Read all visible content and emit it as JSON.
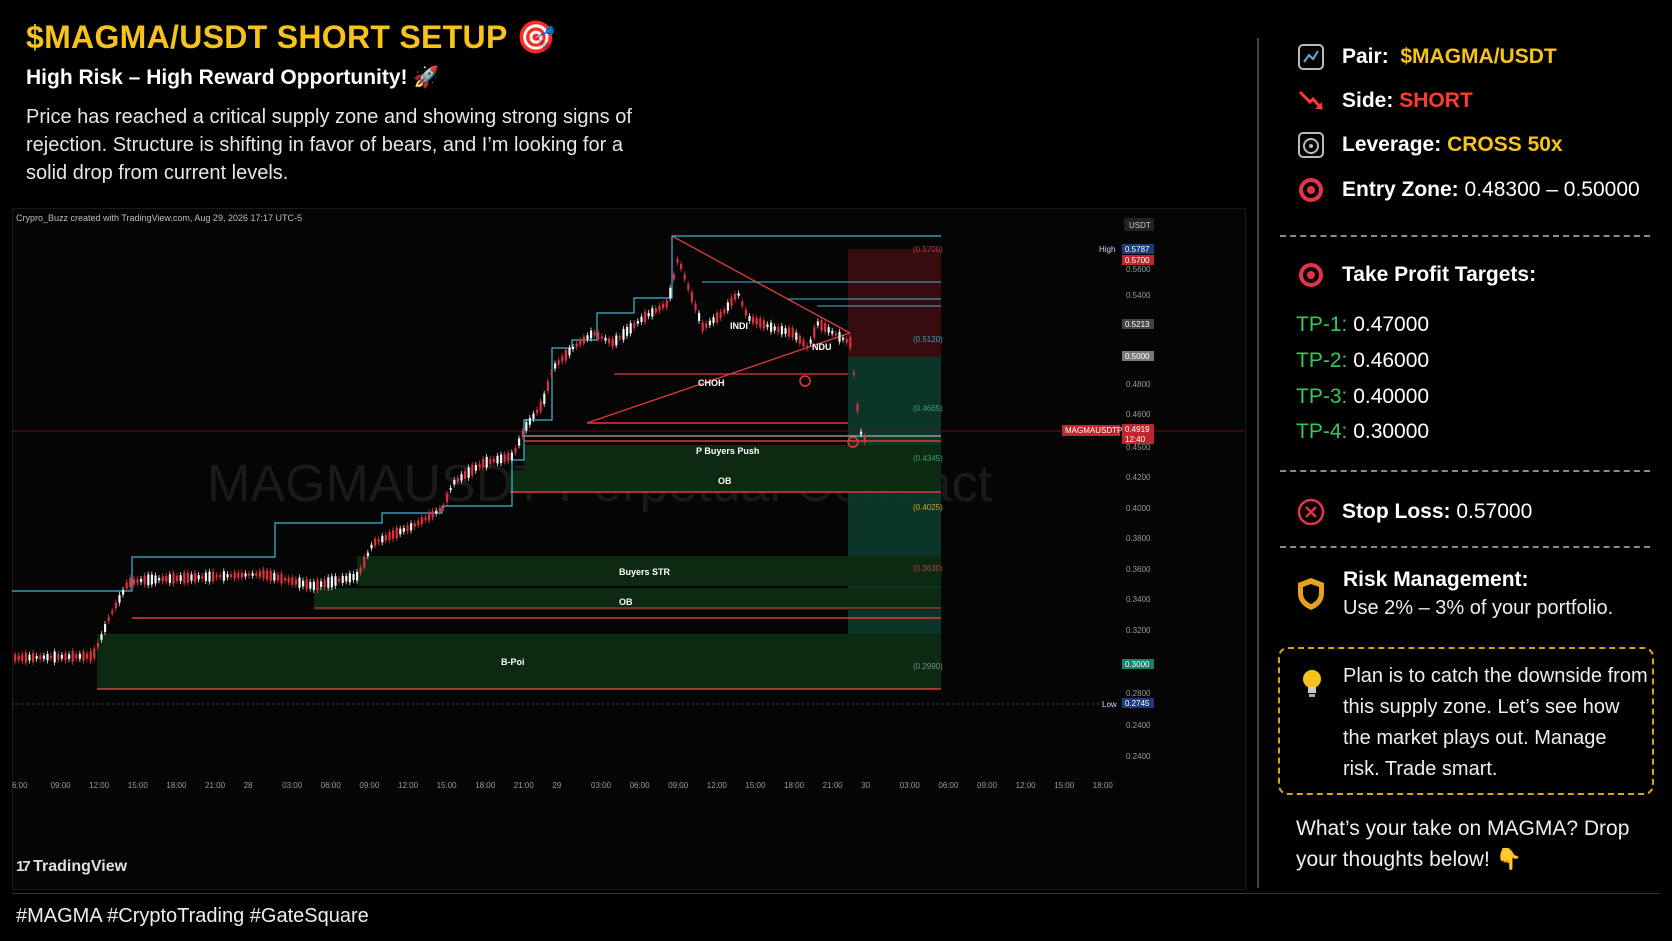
{
  "header": {
    "title": "$MAGMA/USDT SHORT SETUP 🎯",
    "subtitle": "High Risk – High Reward Opportunity! 🚀",
    "description": "Price has reached a critical supply zone and showing strong signs of rejection. Structure is shifting in favor of bears, and I’m looking for a solid drop from current levels."
  },
  "chart": {
    "credit": "Crypro_Buzz created with TradingView.com, Aug 29, 2026 17:17 UTC-5",
    "watermark": "MAGMAUSDT Perpetual Contract",
    "currency": "USDT",
    "logo": "TradingView",
    "annotations": [
      "INDI",
      "NDU",
      "CHOH",
      "P Buyers Push",
      "OB",
      "Buyers STR",
      "OB",
      "B-Poi"
    ],
    "fib_labels": [
      "(0.5700)",
      "(0.5120)",
      "(0.4665)",
      "(0.4345)",
      "(0.4025)",
      "(0.3630)",
      "(0.2990)"
    ],
    "price_ticks": [
      "0.5600",
      "0.5400",
      "0.4800",
      "0.4600",
      "0.4500",
      "0.4200",
      "0.4000",
      "0.3800",
      "0.3600",
      "0.3400",
      "0.3200",
      "0.2800",
      "0.2400",
      "0.2400"
    ],
    "price_tags": {
      "high_label": "High",
      "high_value": "0.5787",
      "sl_value": "0.5700",
      "mid_value": "0.5213",
      "entry_value": "0.5000",
      "symbol_label": "MAGMAUSDTP",
      "last_value": "0.4919",
      "countdown": "12:40",
      "tp_value": "0.3000",
      "low_label": "Low",
      "low_value": "0.2745"
    },
    "time_ticks": [
      "6:00",
      "09:00",
      "12:00",
      "15:00",
      "18:00",
      "21:00",
      "28",
      "03:00",
      "06:00",
      "09:00",
      "12:00",
      "15:00",
      "18:00",
      "21:00",
      "29",
      "03:00",
      "06:00",
      "09:00",
      "12:00",
      "15:00",
      "18:00",
      "21:00",
      "30",
      "03:00",
      "06:00",
      "09:00",
      "12:00",
      "15:00",
      "18:00"
    ]
  },
  "sidebar": {
    "pair_label": "Pair:",
    "pair_value": "$MAGMA/USDT",
    "side_label": "Side:",
    "side_value": "SHORT",
    "leverage_label": "Leverage:",
    "leverage_value": "CROSS 50x",
    "entry_label": "Entry Zone:",
    "entry_value": "0.48300 – 0.50000",
    "tp_title": "Take Profit Targets:",
    "targets": [
      {
        "label": "TP-1:",
        "value": "0.47000"
      },
      {
        "label": "TP-2:",
        "value": "0.46000"
      },
      {
        "label": "TP-3:",
        "value": "0.40000"
      },
      {
        "label": "TP-4:",
        "value": "0.30000"
      }
    ],
    "sl_label": "Stop Loss:",
    "sl_value": "0.57000",
    "risk_title": "Risk Management:",
    "risk_text": "Use 2% – 3% of your portfolio.",
    "plan_text": "Plan is to catch the downside from this supply zone. Let’s see how the market plays out. Manage risk. Trade smart.",
    "take_text": "What’s your take on MAGMA? Drop your thoughts below!"
  },
  "footer": {
    "hashtags": "#MAGMA #CryptoTrading #GateSquare"
  },
  "colors": {
    "accent_yellow": "#f7c31a",
    "short_red": "#ff3b30",
    "tp_green": "#35c85a",
    "zone_green": "#0d3b1c",
    "zone_red": "#3a0d0f"
  }
}
